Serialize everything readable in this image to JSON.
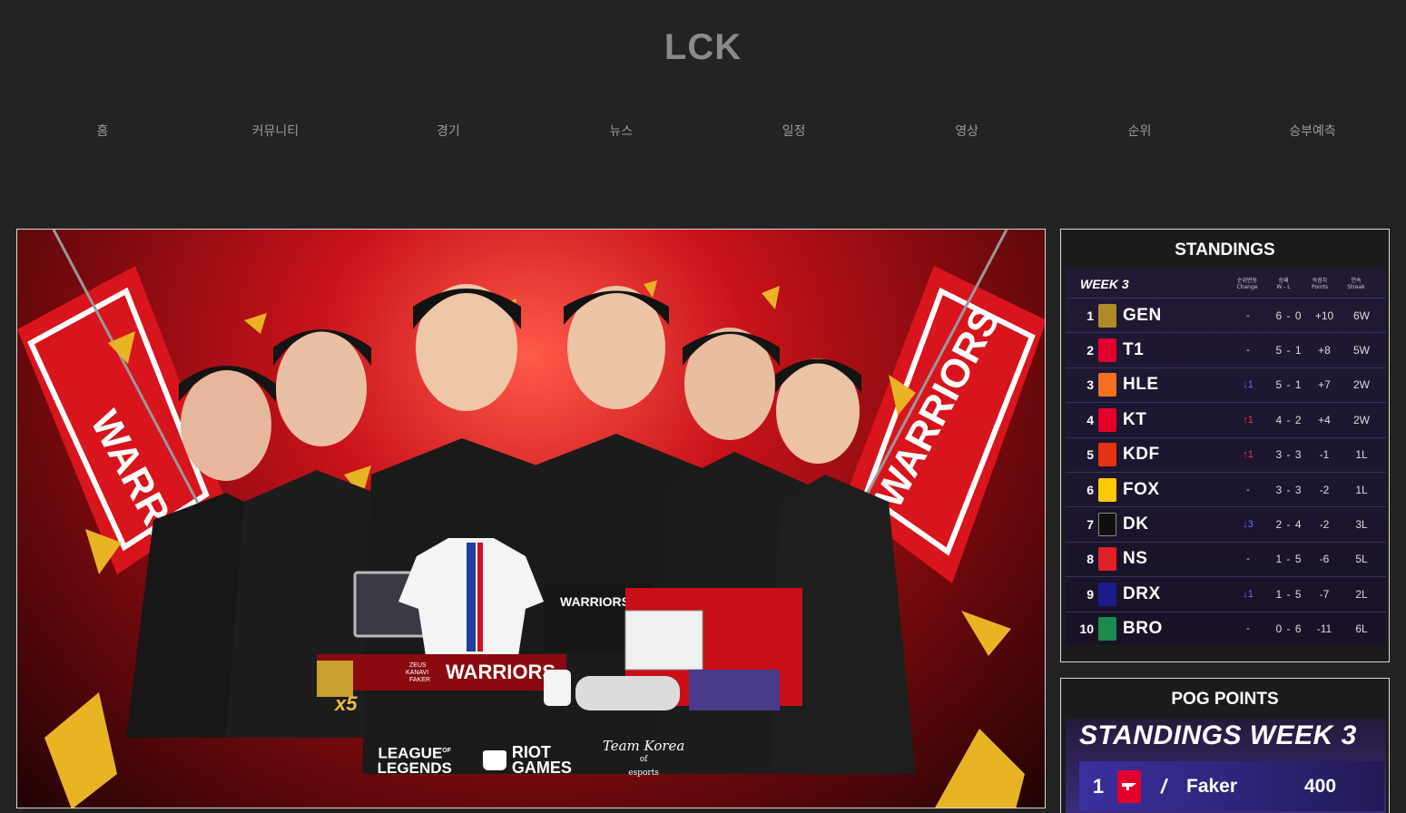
{
  "site": {
    "title": "LCK"
  },
  "nav": [
    "홈",
    "커뮤니티",
    "경기",
    "뉴스",
    "일정",
    "영상",
    "순위",
    "승부예측"
  ],
  "hero": {
    "banner_text": "WARRIORS",
    "scarf_text": "WARRIORS",
    "scarf_names": [
      "ZEUS",
      "KANAVI",
      "FAKER"
    ],
    "multiplier": "x5",
    "logos": {
      "lol_line1": "LEAGUE",
      "lol_line1_sup": "OF",
      "lol_line2": "LEGENDS",
      "riot_line1": "RIOT",
      "riot_line2": "GAMES",
      "tk_line1": "Team Korea",
      "tk_of": "of",
      "tk_line2": "esports"
    }
  },
  "standings": {
    "panel_title": "STANDINGS",
    "week": "WEEK 3",
    "headers": {
      "change": [
        "순위변동",
        "Change"
      ],
      "wl": [
        "승패",
        "W - L"
      ],
      "points": [
        "득점차",
        "Points"
      ],
      "streak": [
        "연속",
        "Streak"
      ]
    },
    "rows": [
      {
        "rank": "1",
        "team": "GEN",
        "badge_color": "#b08a28",
        "change": "-",
        "change_dir": "none",
        "wl": "6 - 0",
        "points": "+10",
        "streak": "6W"
      },
      {
        "rank": "2",
        "team": "T1",
        "badge_color": "#e2012d",
        "change": "-",
        "change_dir": "none",
        "wl": "5 - 1",
        "points": "+8",
        "streak": "5W"
      },
      {
        "rank": "3",
        "team": "HLE",
        "badge_color": "#f37021",
        "change": "↓1",
        "change_dir": "down",
        "wl": "5 - 1",
        "points": "+7",
        "streak": "2W"
      },
      {
        "rank": "4",
        "team": "KT",
        "badge_color": "#e4002b",
        "change": "↑1",
        "change_dir": "up",
        "wl": "4 - 2",
        "points": "+4",
        "streak": "2W"
      },
      {
        "rank": "5",
        "team": "KDF",
        "badge_color": "#e73312",
        "change": "↑1",
        "change_dir": "up",
        "wl": "3 - 3",
        "points": "-1",
        "streak": "1L"
      },
      {
        "rank": "6",
        "team": "FOX",
        "badge_color": "#ffc900",
        "change": "-",
        "change_dir": "none",
        "wl": "3 - 3",
        "points": "-2",
        "streak": "1L"
      },
      {
        "rank": "7",
        "team": "DK",
        "badge_color": "#101010",
        "change": "↓3",
        "change_dir": "down",
        "wl": "2 - 4",
        "points": "-2",
        "streak": "3L"
      },
      {
        "rank": "8",
        "team": "NS",
        "badge_color": "#de2027",
        "change": "-",
        "change_dir": "none",
        "wl": "1 - 5",
        "points": "-6",
        "streak": "5L"
      },
      {
        "rank": "9",
        "team": "DRX",
        "badge_color": "#1a1c8c",
        "change": "↓1",
        "change_dir": "down",
        "wl": "1 - 5",
        "points": "-7",
        "streak": "2L"
      },
      {
        "rank": "10",
        "team": "BRO",
        "badge_color": "#1c8a4c",
        "change": "-",
        "change_dir": "none",
        "wl": "0 - 6",
        "points": "-11",
        "streak": "6L"
      }
    ]
  },
  "pog": {
    "panel_title": "POG POINTS",
    "header": "STANDINGS WEEK 3",
    "top": {
      "rank": "1",
      "player": "Faker",
      "points": "400",
      "badge_color": "#e2012d"
    }
  }
}
